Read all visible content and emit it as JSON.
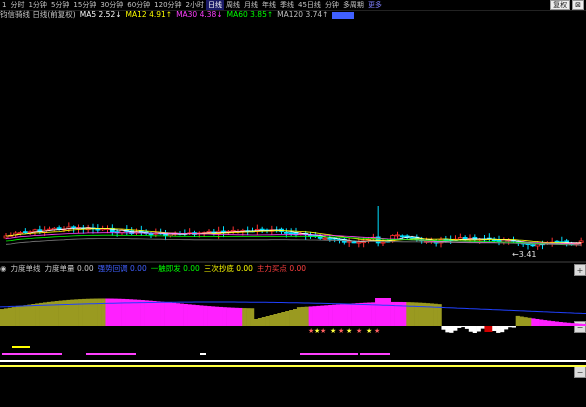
{
  "tabs": [
    "1",
    "分时",
    "1分钟",
    "5分钟",
    "15分钟",
    "30分钟",
    "60分钟",
    "120分钟",
    "2小时",
    "日线",
    "周线",
    "月线",
    "年线",
    "季线",
    "45日线",
    "分钟",
    "多周期",
    "更多"
  ],
  "active_tab_index": 9,
  "right_buttons": [
    "复权",
    "⊠"
  ],
  "main_legend": {
    "title": "钧信骑线 日线(前复权)",
    "items": [
      {
        "label": "MA5",
        "value": "2.52",
        "arrow": "↓",
        "color": "#ffffff"
      },
      {
        "label": "MA12",
        "value": "4.91",
        "arrow": "↑",
        "color": "#ffff00"
      },
      {
        "label": "MA30",
        "value": "4.38",
        "arrow": "↓",
        "color": "#ff40ff"
      },
      {
        "label": "MA60",
        "value": "3.85",
        "arrow": "↑",
        "color": "#00ff00"
      },
      {
        "label": "MA120",
        "value": "3.74",
        "arrow": "↑",
        "color": "#c0c0c0"
      },
      {
        "label": "",
        "value": "",
        "arrow": "",
        "color": "#4060ff"
      }
    ]
  },
  "low_price_label": "←3.41",
  "sub_legend": {
    "title": "力度单线",
    "items": [
      {
        "label": "力度单量",
        "value": "0.00",
        "color": "#c8c8c8"
      },
      {
        "label": "强势回调",
        "value": "0.00",
        "color": "#4060ff"
      },
      {
        "label": "一触即发",
        "value": "0.00",
        "color": "#00ff00"
      },
      {
        "label": "三次抄底",
        "value": "0.00",
        "color": "#ffff00"
      },
      {
        "label": "主力买点",
        "value": "0.00",
        "color": "#ff4040"
      }
    ]
  },
  "side_buttons": [
    "+",
    "−",
    "−"
  ],
  "colors": {
    "up": "#ff3030",
    "down": "#00e0ff",
    "bar_magenta": "#ff20ff",
    "bar_olive": "#9a9a20",
    "bar_white": "#ffffff",
    "bar_red": "#d00000",
    "blue_line": "#2040ff"
  }
}
